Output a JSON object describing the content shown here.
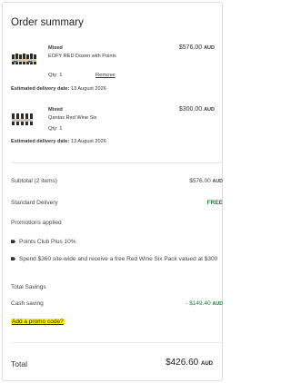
{
  "summary": {
    "title": "Order summary",
    "currency": "AUD",
    "items": [
      {
        "brand": "Mixed",
        "name": "EOFY RED Dozen with Points",
        "qty_label": "Qty: 1",
        "price": "$576.00",
        "remove_label": "Remove",
        "delivery_label": "Estimated delivery date:",
        "delivery_date": "13 August 2026"
      },
      {
        "brand": "Mixed",
        "name": "Qantas Red Wine Six",
        "qty_label": "Qty: 1",
        "price": "$300.00",
        "delivery_label": "Estimated delivery date:",
        "delivery_date": "13 August 2026"
      }
    ],
    "subtotal_label": "Subtotal (2 items)",
    "subtotal_value": "$576.00",
    "delivery_label": "Standard Delivery",
    "delivery_value": "FREE",
    "promotions_title": "Promotions applied",
    "promotions": [
      "Points Club Plus 10%",
      "Spend $360 site-wide and receive a free Red Wine Six Pack valued at $300"
    ],
    "savings_title": "Total Savings",
    "cash_saving_label": "Cash saving",
    "cash_saving_value": "- $149.40",
    "promo_link": "Add a promo code?",
    "total_label": "Total",
    "total_value": "$426.60"
  },
  "colors": {
    "accent_green": "#1a7d3a",
    "highlight": "#fff200"
  }
}
